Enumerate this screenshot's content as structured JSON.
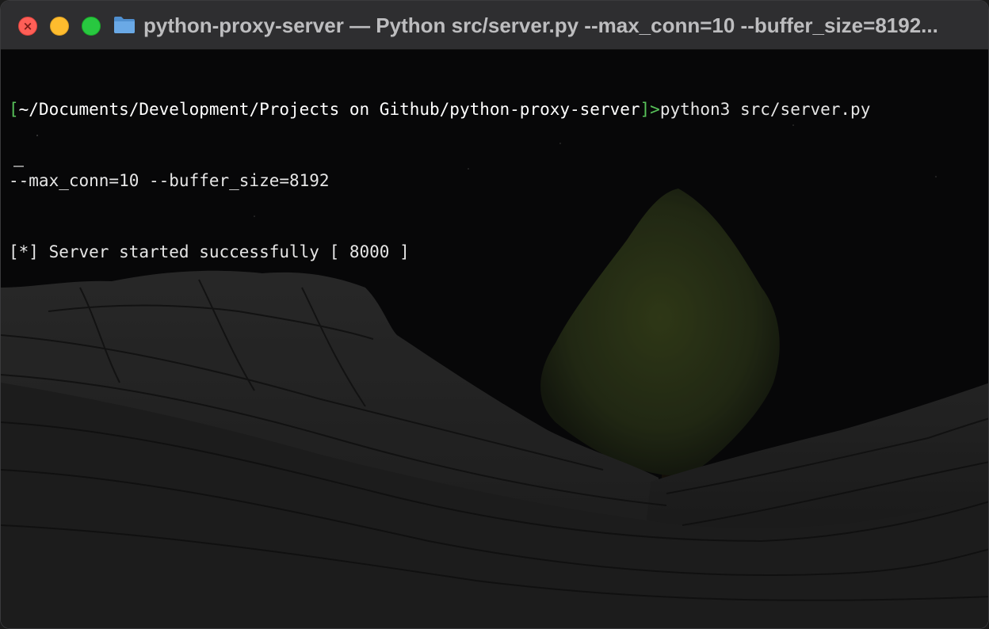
{
  "window": {
    "title": "python-proxy-server — Python src/server.py --max_conn=10 --buffer_size=8192..."
  },
  "icons": {
    "close": "close-icon",
    "minimize": "minimize-icon",
    "zoom": "zoom-icon",
    "folder": "folder-icon"
  },
  "colors": {
    "close": "#fe5f57",
    "minimize": "#febc2e",
    "zoom": "#28c840",
    "prompt_bracket": "#58c35a",
    "folder": "#5b9bd5"
  },
  "terminal": {
    "prompt_open": "[",
    "prompt_path": "~/Documents/Development/Projects on Github/python-proxy-server",
    "prompt_close": "]>",
    "command": "python3 src/server.py ",
    "command_wrap": "--max_conn=10 --buffer_size=8192",
    "output_line": "[*] Server started successfully [ 8000 ]",
    "cursor": "_"
  }
}
